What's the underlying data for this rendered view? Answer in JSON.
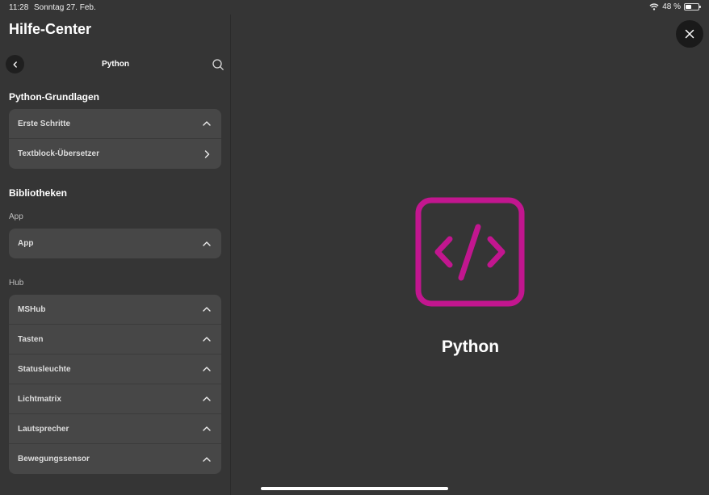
{
  "status_bar": {
    "time": "11:28",
    "date": "Sonntag 27. Feb.",
    "battery": "48 %"
  },
  "sidebar": {
    "app_title": "Hilfe-Center",
    "nav_title": "Python",
    "sections": {
      "basics": {
        "title": "Python-Grundlagen",
        "items": [
          {
            "label": "Erste Schritte",
            "chevron": "chevron-up"
          },
          {
            "label": "Textblock-Übersetzer",
            "chevron": "chevron-right"
          }
        ]
      },
      "libraries": {
        "title": "Bibliotheken",
        "app_label": "App",
        "app_items": [
          {
            "label": "App",
            "chevron": "chevron-up"
          }
        ],
        "hub_label": "Hub",
        "hub_items": [
          {
            "label": "MSHub",
            "chevron": "chevron-up"
          },
          {
            "label": "Tasten",
            "chevron": "chevron-up"
          },
          {
            "label": "Statusleuchte",
            "chevron": "chevron-up"
          },
          {
            "label": "Lichtmatrix",
            "chevron": "chevron-up"
          },
          {
            "label": "Lautsprecher",
            "chevron": "chevron-up"
          },
          {
            "label": "Bewegungssensor",
            "chevron": "chevron-up"
          }
        ]
      }
    }
  },
  "main": {
    "title": "Python",
    "icon": "code-icon",
    "accent_color": "#c2168f"
  }
}
